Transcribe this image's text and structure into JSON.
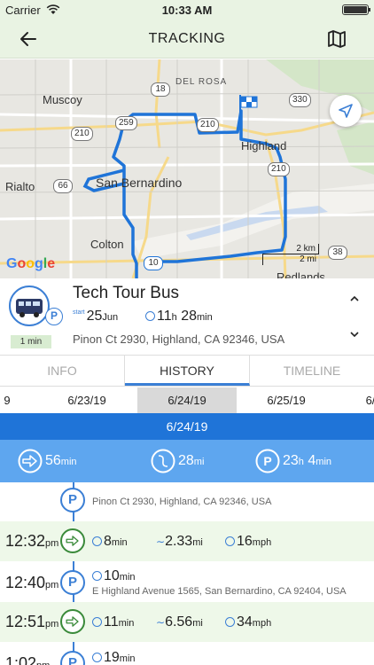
{
  "status_bar": {
    "carrier": "Carrier",
    "time": "10:33 AM"
  },
  "nav": {
    "title": "TRACKING"
  },
  "map": {
    "labels": {
      "del_rosa": "DEL ROSA",
      "muscoy": "Muscoy",
      "highland": "Highland",
      "rialto": "Rialto",
      "san_bernardino": "San Bernardino",
      "colton": "Colton",
      "redlands": "Redlands"
    },
    "shields": [
      "18",
      "330",
      "259",
      "210",
      "210",
      "210",
      "66",
      "10",
      "38"
    ],
    "scale_km": "2 km",
    "scale_mi": "2 mi",
    "attribution": [
      "G",
      "o",
      "o",
      "g",
      "l",
      "e"
    ],
    "route_color": "#1f74d8"
  },
  "vehicle": {
    "name": "Tech Tour Bus",
    "duration_badge": "1 min",
    "start_prefix": "start",
    "start_day": "25",
    "start_month": "Jun",
    "duration_h": "11",
    "duration_h_unit": "h",
    "duration_m": "28",
    "duration_m_unit": "min",
    "address": "Pinon Ct 2930, Highland, CA 92346, USA"
  },
  "tabs": {
    "info": "INFO",
    "history": "HISTORY",
    "timeline": "TIMELINE",
    "active": "history"
  },
  "dates": [
    "9",
    "6/23/19",
    "6/24/19",
    "6/25/19",
    "6/"
  ],
  "selected_date": "6/24/19",
  "summary": {
    "header": "6/24/19",
    "drive_value": "56",
    "drive_unit": "min",
    "distance_value": "28",
    "distance_unit": "mi",
    "park_h": "23",
    "park_h_unit": "h",
    "park_m": "4",
    "park_m_unit": "min"
  },
  "timeline": {
    "start_address": "Pinon Ct 2930, Highland, CA 92346, USA",
    "rows": [
      {
        "type": "drive",
        "time": "12:32",
        "ampm": "pm",
        "dur": "8",
        "dur_unit": "min",
        "dist": "2.33",
        "dist_unit": "mi",
        "speed": "16",
        "speed_unit": "mph"
      },
      {
        "type": "park",
        "time": "12:40",
        "ampm": "pm",
        "dur": "10",
        "dur_unit": "min",
        "address": "E Highland Avenue 1565, San Bernardino, CA 92404, USA"
      },
      {
        "type": "drive",
        "time": "12:51",
        "ampm": "pm",
        "dur": "11",
        "dur_unit": "min",
        "dist": "6.56",
        "dist_unit": "mi",
        "speed": "34",
        "speed_unit": "mph"
      },
      {
        "type": "park",
        "time": "1:02",
        "ampm": "pm",
        "dur": "19",
        "dur_unit": "min"
      }
    ]
  },
  "colors": {
    "accent": "#1f74d8",
    "summary_bg": "#5ea6ef",
    "drive_green": "#3a8a3a",
    "header_green": "#e9f3e3"
  }
}
